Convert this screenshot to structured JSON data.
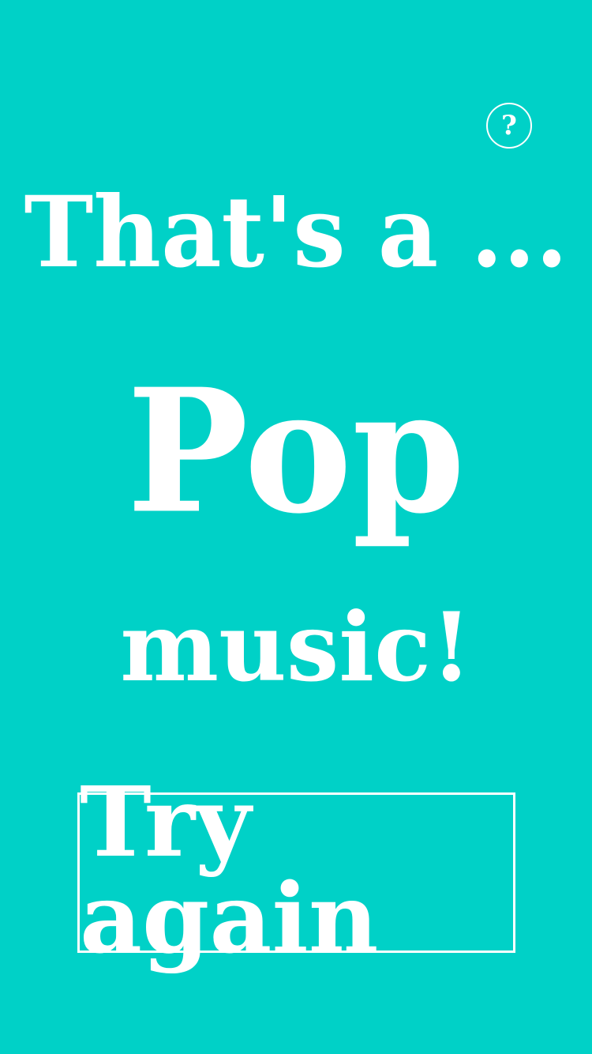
{
  "screen": {
    "intro": "That's a ...",
    "genre": "Pop",
    "outro": "music!",
    "try_again": "Try again",
    "help": "?"
  },
  "colors": {
    "background": "#00D1C7",
    "foreground": "#FFFFFF"
  },
  "icons": {
    "help": "question-mark-icon"
  }
}
